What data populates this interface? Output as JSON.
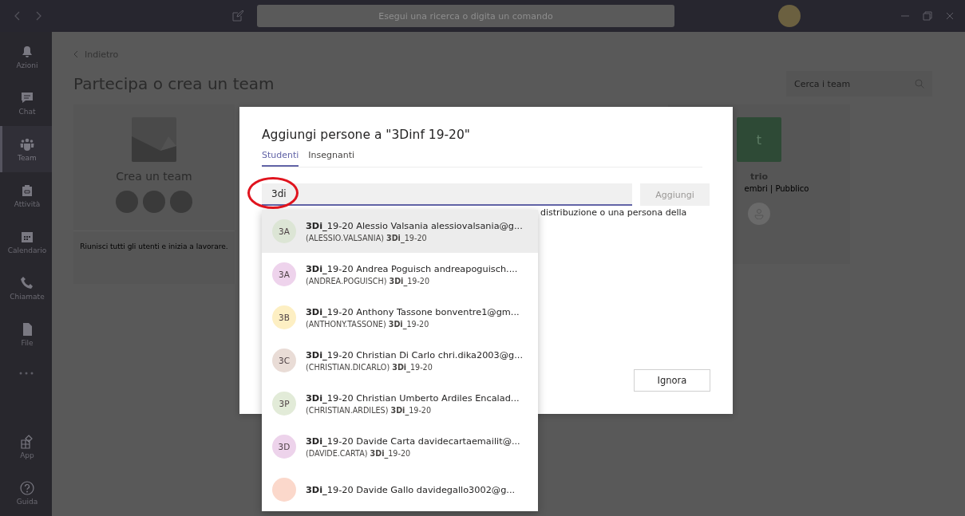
{
  "titlebar": {
    "search_placeholder": "Esegui una ricerca o digita un comando"
  },
  "rail": {
    "items": [
      {
        "label": "Azioni",
        "kind": "bell",
        "selected": false
      },
      {
        "label": "Chat",
        "kind": "chat",
        "selected": false
      },
      {
        "label": "Team",
        "kind": "team",
        "selected": true
      },
      {
        "label": "Attività",
        "kind": "bag",
        "selected": false
      },
      {
        "label": "Calendario",
        "kind": "calendar",
        "selected": false
      },
      {
        "label": "Chiamate",
        "kind": "phone",
        "selected": false
      },
      {
        "label": "File",
        "kind": "file",
        "selected": false
      }
    ],
    "bottom_items": [
      {
        "label": "App",
        "kind": "apps",
        "selected": false
      },
      {
        "label": "Guida",
        "kind": "help",
        "selected": false
      }
    ]
  },
  "page": {
    "back": "Indietro",
    "title": "Partecipa o crea un team",
    "search_placeholder": "Cerca i team"
  },
  "cards": [
    {
      "kind": "create",
      "title": "Crea un team",
      "description": "Riunisci tutti gli utenti e inizia a lavorare."
    },
    {
      "kind": "team",
      "initial": "t",
      "name": "trio",
      "meta": "embri | Pubblico"
    }
  ],
  "dialog": {
    "title": "Aggiungi persone a \"3Dinf 19-20\"",
    "tabs": [
      {
        "label": "Studenti",
        "selected": true
      },
      {
        "label": "Insegnanti",
        "selected": false
      }
    ],
    "input_value": "3di",
    "add_button": {
      "label": "Aggiungi",
      "disabled": true
    },
    "hint": "distribuzione o una persona della",
    "dismiss_button": "Ignora",
    "suggestions": [
      {
        "initials": "3A",
        "color": "#dce5d5",
        "name": "**3Di_**19-20 Alessio Valsania alessiovalsania@g...",
        "detail": "(ALESSIO.VALSANIA) **3Di_**19-20",
        "selected": true
      },
      {
        "initials": "3A",
        "color": "#eed3ec",
        "name": "**3Di_**19-20 Andrea Poguisch andreapoguisch....",
        "detail": "(ANDREA.POGUISCH) **3Di_**19-20",
        "selected": false
      },
      {
        "initials": "3B",
        "color": "#fdefc3",
        "name": "**3Di_**19-20 Anthony Tassone bonventre1@gm...",
        "detail": "(ANTHONY.TASSONE) **3Di_**19-20",
        "selected": false
      },
      {
        "initials": "3C",
        "color": "#e9dcd6",
        "name": "**3Di_**19-20 Christian Di Carlo chri.dika2003@g...",
        "detail": "(CHRISTIAN.DICARLO) **3Di_**19-20",
        "selected": false
      },
      {
        "initials": "3P",
        "color": "#e2ebd8",
        "name": "**3Di_**19-20 Christian Umberto Ardiles Encalad...",
        "detail": "(CHRISTIAN.ARDILES) **3Di_**19-20",
        "selected": false
      },
      {
        "initials": "3D",
        "color": "#edd3eb",
        "name": "**3Di_**19-20 Davide Carta davidecartaemailit@...",
        "detail": "(DAVIDE.CARTA) **3Di_**19-20",
        "selected": false
      },
      {
        "color": "#fbd8cb",
        "name": "**3Di_**19-20 Davide Gallo davidegallo3002@g...",
        "selected": false
      }
    ]
  }
}
